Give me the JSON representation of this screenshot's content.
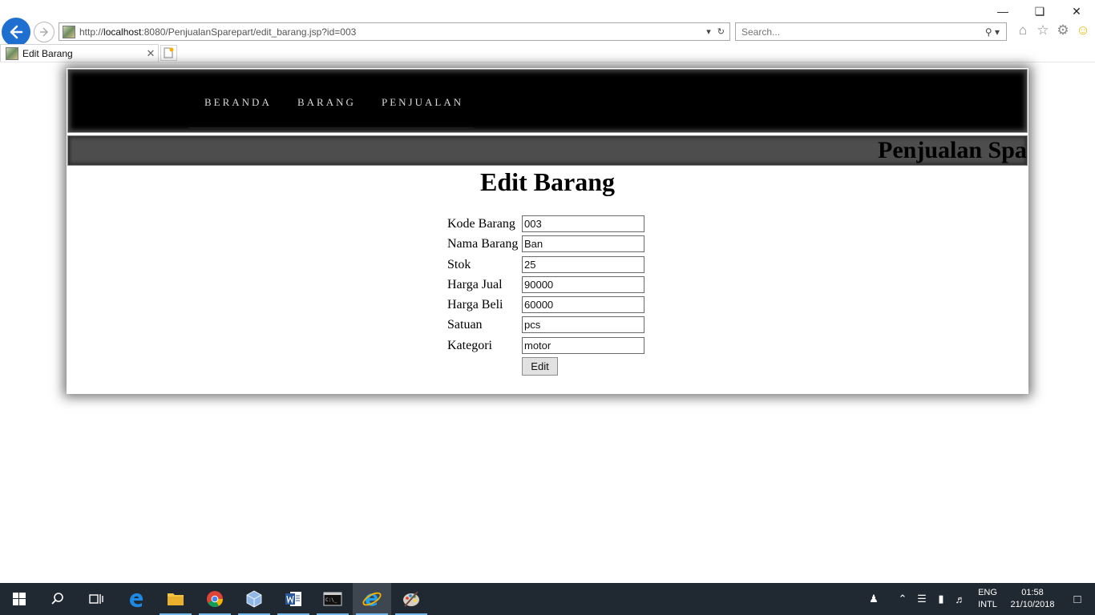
{
  "browser": {
    "url_prefix": "http://",
    "url_host": "localhost",
    "url_rest": ":8080/PenjualanSparepart/edit_barang.jsp?id=003",
    "search_placeholder": "Search...",
    "tab_title": "Edit Barang"
  },
  "nav": {
    "items": [
      "BERANDA",
      "BARANG",
      "PENJUALAN"
    ]
  },
  "banner": {
    "text": "Penjualan Sparepart"
  },
  "page": {
    "title": "Edit Barang"
  },
  "form": {
    "fields": [
      {
        "label": "Kode Barang",
        "value": "003"
      },
      {
        "label": "Nama Barang",
        "value": "Ban"
      },
      {
        "label": "Stok",
        "value": "25"
      },
      {
        "label": "Harga Jual",
        "value": "90000"
      },
      {
        "label": "Harga Beli",
        "value": "60000"
      },
      {
        "label": "Satuan",
        "value": "pcs"
      },
      {
        "label": "Kategori",
        "value": "motor"
      }
    ],
    "submit_label": "Edit"
  },
  "taskbar": {
    "lang_line1": "ENG",
    "lang_line2": "INTL",
    "time": "01:58",
    "date": "21/10/2018"
  }
}
